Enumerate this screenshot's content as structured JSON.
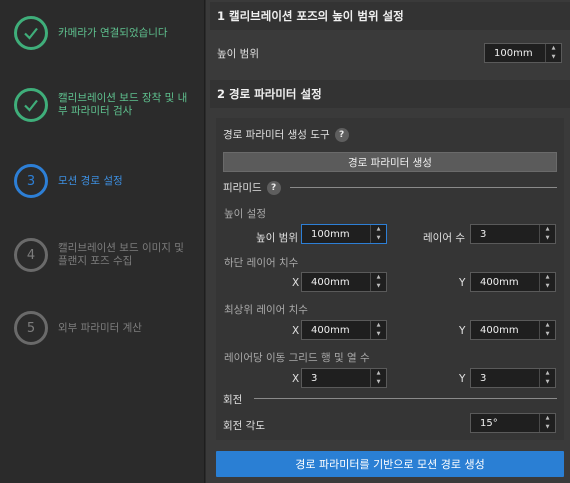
{
  "steps": [
    {
      "label": "카메라가 연결되었습니다",
      "state": "done",
      "icon": "check-icon"
    },
    {
      "label": "캘리브레이션 보드 장착 및 내부 파라미터 검사",
      "state": "done",
      "icon": "check-icon"
    },
    {
      "label": "모션 경로 설정",
      "state": "active",
      "number": "3"
    },
    {
      "label": "캘리브레이션 보드 이미지 및 플랜지 포즈 수집",
      "state": "pending",
      "number": "4"
    },
    {
      "label": "외부 파라미터 계산",
      "state": "pending",
      "number": "5"
    }
  ],
  "section1": {
    "title": "1 캘리브레이션 포즈의 높이 범위 설정",
    "height_range_label": "높이 범위",
    "height_range_value": "100mm"
  },
  "section2": {
    "title": "2 경로 파라미터 설정",
    "tool_label": "경로 파라미터 생성 도구",
    "generate_button": "경로 파라미터 생성",
    "pyramid_label": "피라미드",
    "height_settings_label": "높이 설정",
    "height_range_label": "높이 범위",
    "height_range_value": "100mm",
    "layer_count_label": "레이어 수",
    "layer_count_value": "3",
    "bottom_layer_label": "하단 레이어 치수",
    "bottom_x_label": "X",
    "bottom_x_value": "400mm",
    "bottom_y_label": "Y",
    "bottom_y_value": "400mm",
    "top_layer_label": "최상위 레이어 치수",
    "top_x_label": "X",
    "top_x_value": "400mm",
    "top_y_label": "Y",
    "top_y_value": "400mm",
    "grid_label": "레이어당 이동 그리드 행 및 열 수",
    "grid_x_label": "X",
    "grid_x_value": "3",
    "grid_y_label": "Y",
    "grid_y_value": "3",
    "rotation_label": "회전",
    "rotation_angle_label": "회전 각도",
    "rotation_angle_value": "15°",
    "help_glyph": "?"
  },
  "footer": {
    "generate_path_button": "경로 파라미터를 기반으로 모션 경로 생성"
  },
  "colors": {
    "done": "#3fae7a",
    "active": "#2d7fd6",
    "pending": "#6a6a6a",
    "primary_button": "#2a7fd4"
  }
}
